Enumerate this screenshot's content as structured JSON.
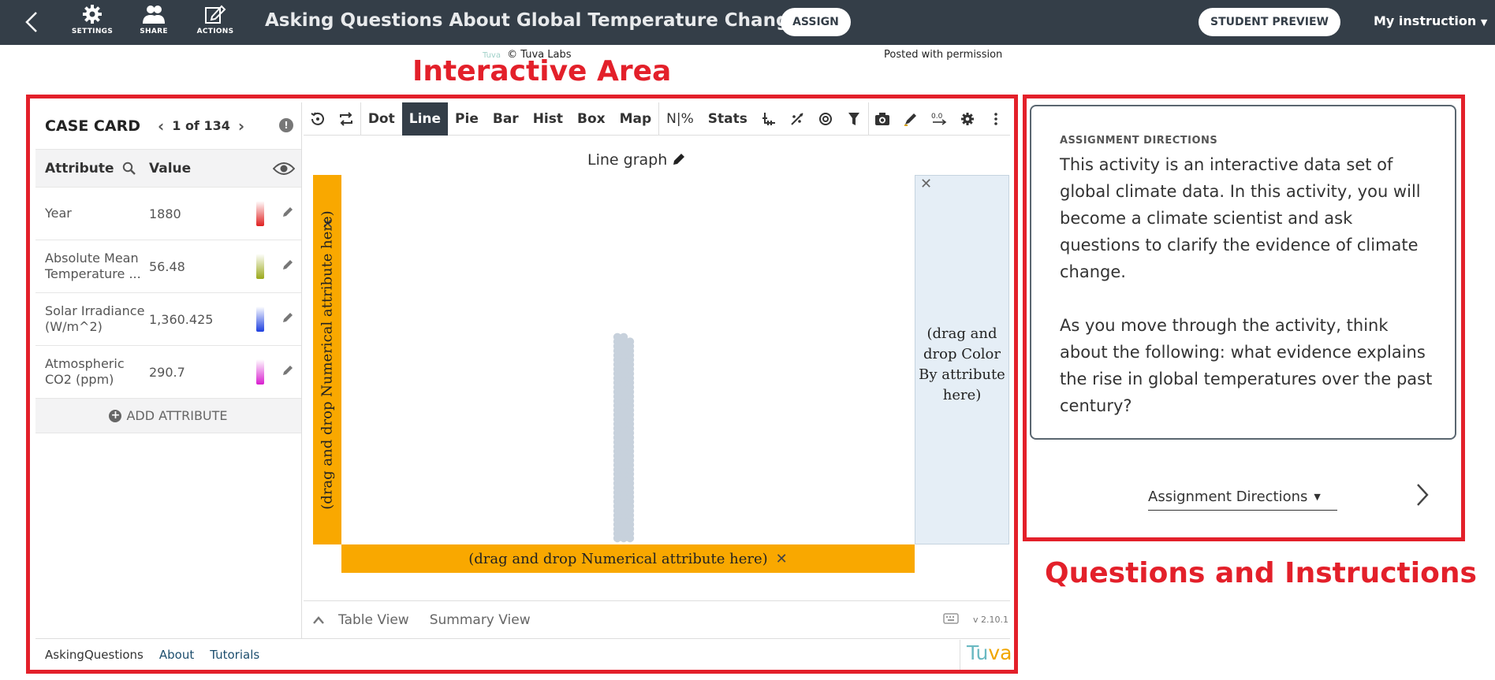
{
  "header": {
    "title": "Asking Questions About Global Temperature Change",
    "tools": [
      {
        "label": "SETTINGS",
        "icon": "gear-icon"
      },
      {
        "label": "SHARE",
        "icon": "people-icon"
      },
      {
        "label": "ACTIONS",
        "icon": "edit-icon"
      }
    ],
    "assign_label": "ASSIGN",
    "student_preview_label": "STUDENT PREVIEW",
    "my_instruction_label": "My instruction"
  },
  "credits": {
    "copyright": "© Tuva Labs",
    "tuva_mini": "Tuva",
    "permission": "Posted with permission"
  },
  "annotations": {
    "interactive_area": "Interactive Area",
    "questions": "Questions and Instructions"
  },
  "case_card": {
    "title": "CASE CARD",
    "position": "1 of 134",
    "attribute_header": "Attribute",
    "value_header": "Value",
    "rows": [
      {
        "attribute": "Year",
        "value": "1880",
        "color": "#e02020"
      },
      {
        "attribute": "Absolute Mean Temperature ...",
        "value": "56.48",
        "color": "#9aa81a"
      },
      {
        "attribute": "Solar Irradiance (W/m^2)",
        "value": "1,360.425",
        "color": "#1d3fe0"
      },
      {
        "attribute": "Atmospheric CO2 (ppm)",
        "value": "290.7",
        "color": "#d81ecf"
      }
    ],
    "add_attribute_label": "ADD ATTRIBUTE"
  },
  "graph_toolbar": {
    "graph_types": [
      "Dot",
      "Line",
      "Pie",
      "Bar",
      "Hist",
      "Box",
      "Map"
    ],
    "active_type": "Line",
    "count_percent_label": "N|%",
    "stats_label": "Stats"
  },
  "graph": {
    "title": "Line graph",
    "y_drop_label": "(drag and drop Numerical attribute here)",
    "x_drop_label": "(drag and drop Numerical attribute here)",
    "color_drop_label": "(drag and drop Color By attribute here)",
    "dot_count": 134,
    "dot_color": "#c7d1dc"
  },
  "bottom_tabs": {
    "table_view": "Table View",
    "summary_view": "Summary View",
    "version": "v 2.10.1"
  },
  "footer": {
    "app_name": "AskingQuestions",
    "about": "About",
    "tutorials": "Tutorials",
    "logo_a": "Tu",
    "logo_b": "va"
  },
  "directions": {
    "kicker": "ASSIGNMENT DIRECTIONS",
    "paragraph1": "This activity is an interactive data set of global climate data. In this activity, you will become a climate scientist and ask questions to clarify the evidence of climate change.",
    "paragraph2": "As you move through the activity, think about the following: what evidence explains the rise in global temperatures over the past century?",
    "selector_label": "Assignment Directions"
  },
  "colors": {
    "topbar": "#343e48",
    "accent_red": "#e3202a",
    "drop_zone": "#f9a800",
    "color_zone": "#e5eef6"
  }
}
